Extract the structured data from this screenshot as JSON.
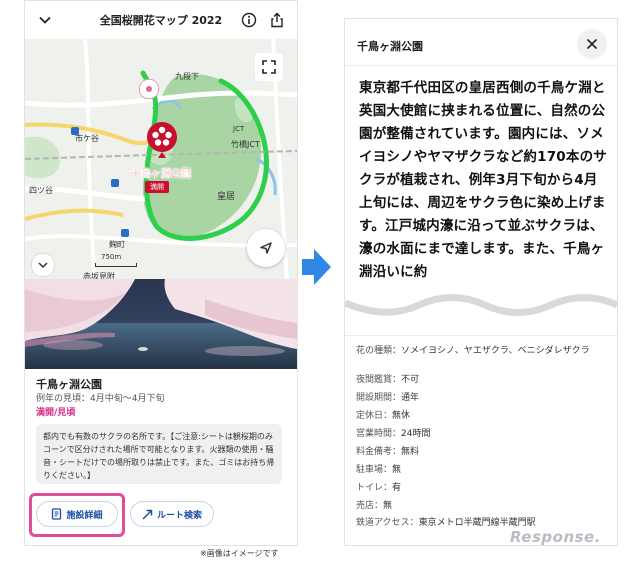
{
  "left_screen": {
    "header": {
      "title": "全国桜開花マップ 2022",
      "back_icon": "chevron-down-icon",
      "info_icon": "info-icon",
      "share_icon": "share-icon"
    },
    "map": {
      "spot_label": "千鳥ヶ淵公園",
      "spot_badge": "満開",
      "place_labels": {
        "kudanshita": "九段下",
        "ichigaya": "市ケ谷",
        "jct": "JCT",
        "takehashi_jct": "竹橋JCT",
        "kokyo": "皇居",
        "yotsuya": "四ツ谷",
        "kojimachi": "麹町",
        "akasaka": "赤坂見附"
      },
      "scale_label": "750m"
    },
    "spot": {
      "name": "千鳥ヶ淵公園",
      "period": "例年の見頃：4月中旬～4月下旬",
      "status": "満開/見頃",
      "description": "都内でも有数のサクラの名所です。【ご注意:シートは観桜期のみコーンで区分けされた場所で可能となります。火器類の使用・騒音・シートだけでの場所取りは禁止です。また、ゴミはお持ち帰りください。】"
    },
    "buttons": {
      "detail": "施設詳細",
      "route": "ルート検索"
    },
    "note": "※画像はイメージです",
    "colors": {
      "highlight": "#e14c9a",
      "sakura_pin": "#c8102e",
      "route": "#2ecf4b"
    }
  },
  "arrow_color": "#2f87e6",
  "right_screen": {
    "title": "千鳥ヶ淵公園",
    "close_icon": "close-icon",
    "big_text": "東京都千代田区の皇居西側の千鳥ケ淵と英国大使館に挟まれる位置に、自然の公園が整備されています。園内には、ソメイヨシノやヤマザクラなど約170本のサクラが植栽され、例年3月下旬から4月上旬には、周辺をサクラ色に染め上げます。江戸城内濠に沿って並ぶサクラは、濠の水面にまで達します。また、千鳥ヶ淵沿いに約",
    "attributes": [
      {
        "key": "花の種類：",
        "value": "ソメイヨシノ、ヤエザクラ、ベニシダレザクラ"
      },
      {
        "key": "夜間鑑賞：",
        "value": "不可"
      },
      {
        "key": "開設期間：",
        "value": "通年"
      },
      {
        "key": "定休日：",
        "value": "無休"
      },
      {
        "key": "営業時間：",
        "value": "24時間"
      },
      {
        "key": "料金備考：",
        "value": "無料"
      },
      {
        "key": "駐車場：",
        "value": "無"
      },
      {
        "key": "トイレ：",
        "value": "有"
      },
      {
        "key": "売店：",
        "value": "無"
      },
      {
        "key": "鉄道アクセス：",
        "value": "東京メトロ半蔵門線半蔵門駅"
      }
    ]
  },
  "watermark": "Response."
}
